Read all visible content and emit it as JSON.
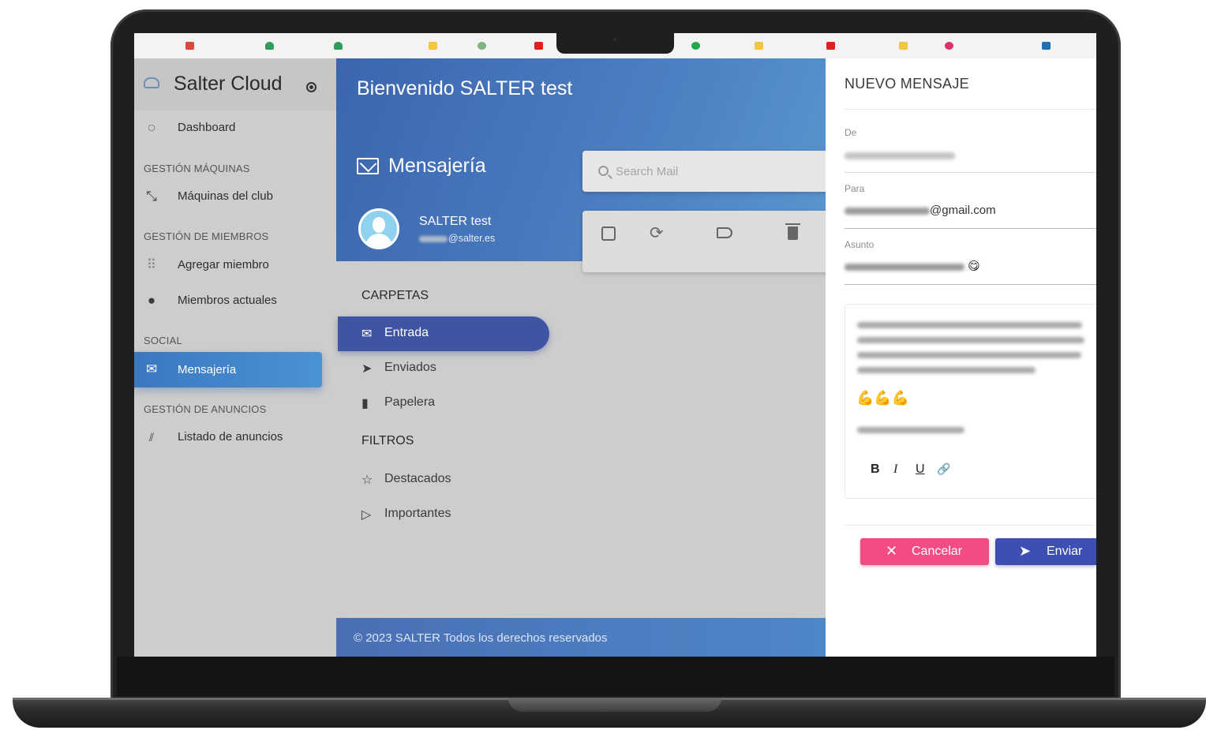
{
  "brand": {
    "title": "Salter Cloud"
  },
  "sidebar": {
    "dashboard": "Dashboard",
    "section_machines": "GESTIÓN MÁQUINAS",
    "machines": "Máquinas del club",
    "section_members": "GESTIÓN DE MIEMBROS",
    "add_member": "Agregar miembro",
    "current_members": "Miembros actuales",
    "section_social": "SOCIAL",
    "messaging": "Mensajería",
    "section_ads": "GESTIÓN DE ANUNCIOS",
    "ads_list": "Listado de anuncios"
  },
  "header": {
    "welcome": "Bienvenido SALTER test",
    "section_title": "Mensajería"
  },
  "user": {
    "name": "SALTER test",
    "email_domain": "@salter.es"
  },
  "search": {
    "placeholder": "Search Mail"
  },
  "folders": {
    "heading": "CARPETAS",
    "items": [
      "Entrada",
      "Enviados",
      "Papelera"
    ]
  },
  "filters": {
    "heading": "FILTROS",
    "items": [
      "Destacados",
      "Importantes"
    ]
  },
  "footer": {
    "text": "© 2023 SALTER Todos los derechos reservados"
  },
  "compose": {
    "title": "NUEVO MENSAJE",
    "from_label": "De",
    "to_label": "Para",
    "to_visible": "@gmail.com",
    "subject_label": "Asunto",
    "subject_emoji": "😋",
    "body_emoji": "💪💪💪",
    "format_buttons": [
      "B",
      "I",
      "U",
      "🔗"
    ],
    "cancel_label": "Cancelar",
    "send_label": "Enviar"
  },
  "colors": {
    "accent_blue": "#3f54a3",
    "hero_blue": "#4c7fc1",
    "cancel_pink": "#f14d84",
    "send_indigo": "#3d4fb3"
  }
}
